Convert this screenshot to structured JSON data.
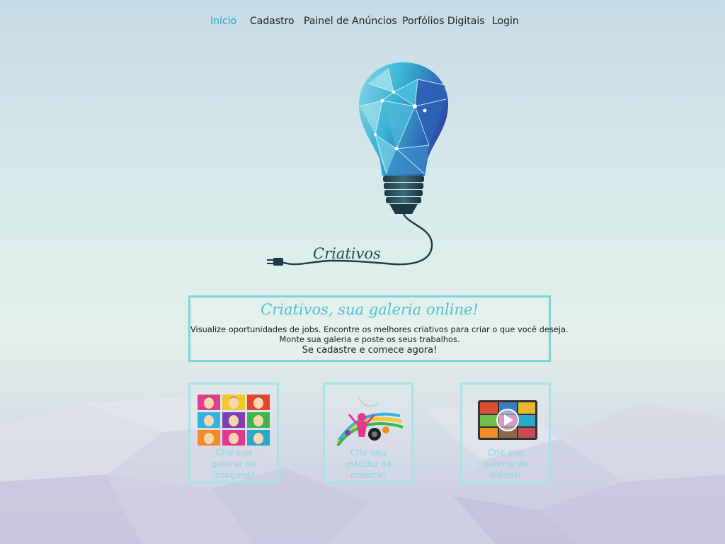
{
  "nav": {
    "items": [
      {
        "label": "Início",
        "active": true
      },
      {
        "label": "Cadastro",
        "active": false
      },
      {
        "label": "Painel de Anúncios",
        "active": false
      },
      {
        "label": "Porfólios Digitais",
        "active": false
      },
      {
        "label": "Login",
        "active": false
      }
    ]
  },
  "logo": {
    "word": "Criativos"
  },
  "intro": {
    "title": "Criativos, sua galeria online!",
    "line1": "Visualize oportunidades de jobs. Encontre os melhores criativos para criar o que você deseja.",
    "line2": "Monte sua galeria e poste os seus trabalhos.",
    "cta": "Se cadastre e comece agora!"
  },
  "cards": [
    {
      "lines": [
        "Crie sua",
        "galeria de",
        "imagens!"
      ]
    },
    {
      "lines": [
        "Crie seu",
        "estúdio de",
        "música!"
      ]
    },
    {
      "lines": [
        "Crie sua",
        "galeria de",
        "vídeos!"
      ]
    }
  ],
  "colors": {
    "accent": "#17a6c9",
    "box_border": "#7fd3dc",
    "title_script": "#4ac2cf",
    "card_text": "#8fd6de"
  }
}
